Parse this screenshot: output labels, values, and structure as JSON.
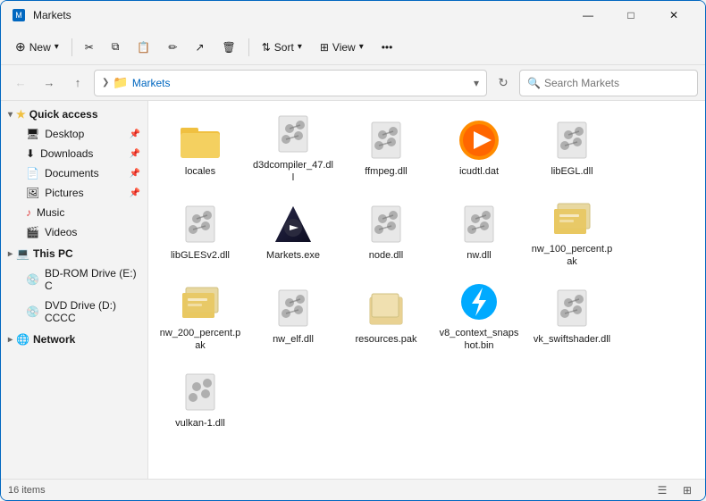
{
  "window": {
    "title": "Markets",
    "minimize": "—",
    "maximize": "□",
    "close": "✕"
  },
  "toolbar": {
    "new_label": "New",
    "sort_label": "Sort",
    "view_label": "View",
    "more_label": "•••"
  },
  "addressbar": {
    "path_folder": "Markets",
    "search_placeholder": "Search Markets"
  },
  "sidebar": {
    "quick_access_label": "Quick access",
    "items": [
      {
        "id": "desktop",
        "label": "Desktop",
        "icon": "desktop"
      },
      {
        "id": "downloads",
        "label": "Downloads",
        "icon": "downloads"
      },
      {
        "id": "documents",
        "label": "Documents",
        "icon": "documents"
      },
      {
        "id": "pictures",
        "label": "Pictures",
        "icon": "pictures"
      },
      {
        "id": "music",
        "label": "Music",
        "icon": "music"
      },
      {
        "id": "videos",
        "label": "Videos",
        "icon": "videos"
      }
    ],
    "thispc_label": "This PC",
    "drives": [
      {
        "id": "bd",
        "label": "BD-ROM Drive (E:) C"
      },
      {
        "id": "dvd",
        "label": "DVD Drive (D:) CCCC"
      }
    ],
    "network_label": "Network"
  },
  "files": [
    {
      "id": "locales",
      "name": "locales",
      "type": "folder"
    },
    {
      "id": "d3d",
      "name": "d3dcompiler_47.dll",
      "type": "dll"
    },
    {
      "id": "ffmpeg",
      "name": "ffmpeg.dll",
      "type": "dll"
    },
    {
      "id": "icudtl",
      "name": "icudtl.dat",
      "type": "media"
    },
    {
      "id": "libegl",
      "name": "libEGL.dll",
      "type": "dll"
    },
    {
      "id": "libgles",
      "name": "libGLESv2.dll",
      "type": "dll"
    },
    {
      "id": "markets",
      "name": "Markets.exe",
      "type": "exe"
    },
    {
      "id": "node",
      "name": "node.dll",
      "type": "dll"
    },
    {
      "id": "nw",
      "name": "nw.dll",
      "type": "dll"
    },
    {
      "id": "nw100",
      "name": "nw_100_percent.pak",
      "type": "pak"
    },
    {
      "id": "nw200",
      "name": "nw_200_percent.pak",
      "type": "pak"
    },
    {
      "id": "nwelf",
      "name": "nw_elf.dll",
      "type": "dll"
    },
    {
      "id": "resources",
      "name": "resources.pak",
      "type": "pak2"
    },
    {
      "id": "v8context",
      "name": "v8_context_snapshot.bin",
      "type": "bolt"
    },
    {
      "id": "vkswift",
      "name": "vk_swiftshader.dll",
      "type": "dll"
    },
    {
      "id": "vulkan",
      "name": "vulkan-1.dll",
      "type": "dll2"
    }
  ],
  "status": {
    "item_count": "16 items"
  }
}
